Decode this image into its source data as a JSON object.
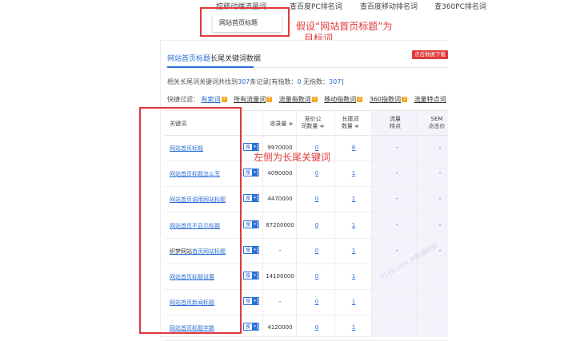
{
  "top_nav": {
    "items": [
      "挖移动端流量词",
      "查百度PC排名词",
      "查百度移动排名词",
      "查360PC排名词"
    ]
  },
  "subtitle_tab": "网站首页标题",
  "annotations": {
    "top_line1": "假设“网站首页标题”为",
    "top_line2": "目标词",
    "left": "左侧为长尾关键词"
  },
  "panel": {
    "title_highlight": "网站首页标题",
    "title_rest": "长尾关键词数据",
    "export_label": "点击数据下载",
    "summary": {
      "prefix": "相关长尾词关键词共找到",
      "count": "307",
      "mid": "条记录[有指数：",
      "with_index": "0",
      "sep": " 无指数：",
      "no_index": "307",
      "suffix": "]"
    },
    "filters_label": "快捷过滤：",
    "filters": [
      "有索词",
      "所有流量词",
      "流量指数词",
      "移动指数词",
      "360指数词",
      "流量特点词"
    ]
  },
  "table": {
    "headers": {
      "keyword": "关键词",
      "index": "收录量",
      "bidders": [
        "竞价公",
        "司数量"
      ],
      "long_tail": [
        "长尾词",
        "数量"
      ],
      "traffic": [
        "流量",
        "特点"
      ],
      "sem": [
        "SEM",
        "点击价"
      ]
    },
    "sort_glyph": "≑",
    "dd_label": "搜",
    "dd_caret": "▾",
    "empty": "-",
    "rows": [
      {
        "keyword": "网站首页标题",
        "prefix": "",
        "index": "9970000",
        "bidders": "0",
        "long_tail": "8",
        "traffic": "-",
        "sem": "-"
      },
      {
        "keyword": "网站首页标题怎么写",
        "prefix": "",
        "index": "4090000",
        "bidders": "0",
        "long_tail": "1",
        "traffic": "-",
        "sem": "-"
      },
      {
        "keyword": "网站首页调用网站标题",
        "prefix": "",
        "index": "4470000",
        "bidders": "0",
        "long_tail": "1",
        "traffic": "-",
        "sem": "-"
      },
      {
        "keyword": "网站首页不显示标题",
        "prefix": "",
        "index": "87200000",
        "bidders": "0",
        "long_tail": "1",
        "traffic": "-",
        "sem": "-"
      },
      {
        "keyword": "首页网站标题",
        "prefix": "织梦网站",
        "index": "-",
        "bidders": "0",
        "long_tail": "1",
        "traffic": "-",
        "sem": "-"
      },
      {
        "keyword": "网站首页标题设置",
        "prefix": "",
        "index": "14100000",
        "bidders": "0",
        "long_tail": "1",
        "traffic": "",
        "sem": ""
      },
      {
        "keyword": "网站首页新闻标题",
        "prefix": "",
        "index": "-",
        "bidders": "0",
        "long_tail": "1",
        "traffic": "",
        "sem": ""
      },
      {
        "keyword": "网站首页标题字数",
        "prefix": "",
        "index": "4120000",
        "bidders": "0",
        "long_tail": "1",
        "traffic": "",
        "sem": ""
      }
    ]
  },
  "watermark": "5118.com 大数据挖掘",
  "colors": {
    "accent": "#2a6fd6",
    "annotation": "#e0383a"
  }
}
